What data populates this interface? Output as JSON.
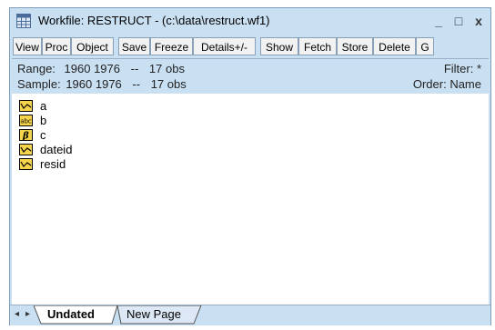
{
  "window": {
    "title": "Workfile: RESTRUCT - (c:\\data\\restruct.wf1)",
    "minimize": "_",
    "maximize": "□",
    "close": "x"
  },
  "toolbar": {
    "buttons": [
      "View",
      "Proc",
      "Object",
      "Save",
      "Freeze",
      "Details+/-",
      "Show",
      "Fetch",
      "Store",
      "Delete",
      "G"
    ]
  },
  "info": {
    "range_label": "Range:",
    "range_value": "1960 1976",
    "range_sep": "--",
    "range_obs": "17 obs",
    "sample_label": "Sample:",
    "sample_value": "1960 1976",
    "sample_sep": "--",
    "sample_obs": "17 obs",
    "filter": "Filter: *",
    "order": "Order: Name"
  },
  "objects": [
    {
      "name": "a",
      "icon": "series-icon"
    },
    {
      "name": "b",
      "icon": "alpha-icon"
    },
    {
      "name": "c",
      "icon": "coef-icon"
    },
    {
      "name": "dateid",
      "icon": "series-icon"
    },
    {
      "name": "resid",
      "icon": "series-icon"
    }
  ],
  "tabs": {
    "nav_prev": "◂",
    "nav_next": "▸",
    "active": "Undated",
    "other": "New Page"
  },
  "colors": {
    "frame": "#c9dff2",
    "icon_yellow": "#f5d34a"
  }
}
